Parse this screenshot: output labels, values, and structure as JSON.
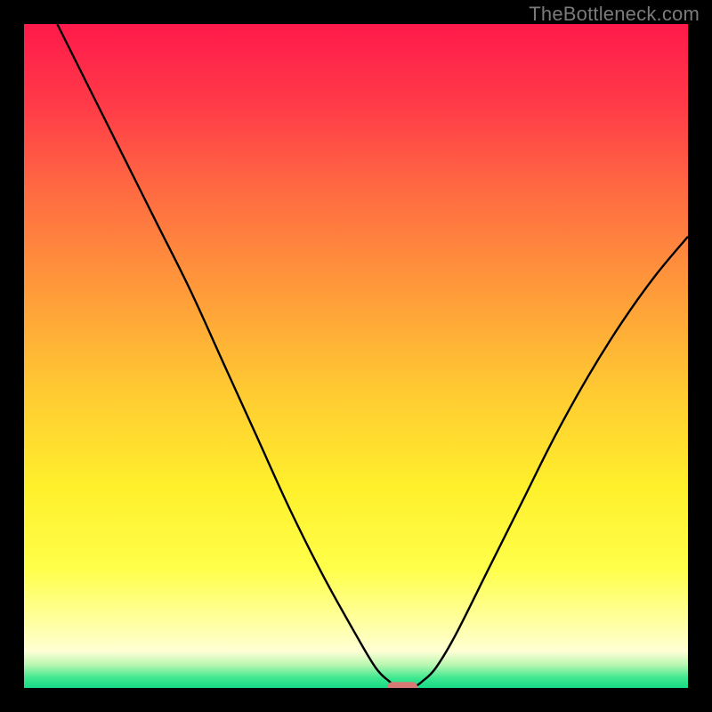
{
  "attribution": "TheBottleneck.com",
  "chart_data": {
    "type": "line",
    "title": "",
    "xlabel": "",
    "ylabel": "",
    "xlim": [
      0,
      100
    ],
    "ylim": [
      0,
      100
    ],
    "grid": false,
    "legend": false,
    "series": [
      {
        "name": "bottleneck-curve",
        "color": "#000000",
        "x": [
          0,
          5,
          10,
          15,
          20,
          25,
          30,
          35,
          40,
          45,
          50,
          53,
          55,
          56,
          57,
          58,
          59,
          60,
          62,
          65,
          70,
          75,
          80,
          85,
          90,
          95,
          100
        ],
        "y": [
          null,
          100,
          90,
          80,
          70,
          60,
          49,
          38,
          27,
          17,
          8,
          3,
          1,
          0.3,
          0,
          0,
          0.3,
          1,
          3,
          8,
          18,
          28,
          38,
          47,
          55,
          62,
          68
        ]
      }
    ],
    "marker": {
      "x": 57,
      "y": 0.2,
      "width": 4.5,
      "height": 1.4,
      "color": "#d77a74"
    },
    "background": {
      "gradient_stops": [
        {
          "offset": 0.0,
          "color": "#ff1a4b"
        },
        {
          "offset": 0.12,
          "color": "#ff3a48"
        },
        {
          "offset": 0.25,
          "color": "#ff6a42"
        },
        {
          "offset": 0.4,
          "color": "#ff9a3a"
        },
        {
          "offset": 0.55,
          "color": "#ffc932"
        },
        {
          "offset": 0.7,
          "color": "#fff02c"
        },
        {
          "offset": 0.82,
          "color": "#ffff4a"
        },
        {
          "offset": 0.9,
          "color": "#ffffa0"
        },
        {
          "offset": 0.945,
          "color": "#ffffd5"
        },
        {
          "offset": 0.965,
          "color": "#b9f7b1"
        },
        {
          "offset": 0.985,
          "color": "#3de88f"
        },
        {
          "offset": 1.0,
          "color": "#16da86"
        }
      ]
    }
  }
}
